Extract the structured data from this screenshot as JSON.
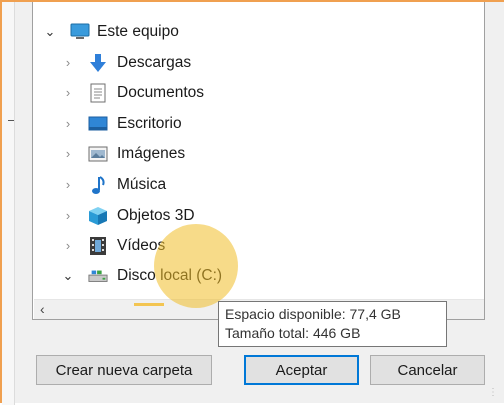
{
  "tree": {
    "items": [
      {
        "label": "Este equipo",
        "icon": "monitor-icon",
        "expanded": true
      },
      {
        "label": "Descargas",
        "icon": "download-arrow-icon"
      },
      {
        "label": "Documentos",
        "icon": "document-icon"
      },
      {
        "label": "Escritorio",
        "icon": "desktop-icon"
      },
      {
        "label": "Imágenes",
        "icon": "pictures-icon"
      },
      {
        "label": "Música",
        "icon": "music-note-icon"
      },
      {
        "label": "Objetos 3D",
        "icon": "3d-cube-icon"
      },
      {
        "label": "Vídeos",
        "icon": "film-icon"
      },
      {
        "label": "Disco local (C:)",
        "icon": "drive-icon",
        "expanded": true
      }
    ]
  },
  "tooltip": {
    "line1": "Espacio disponible: 77,4 GB",
    "line2": "Tamaño total: 446 GB"
  },
  "buttons": {
    "new_folder": "Crear nueva carpeta",
    "accept": "Aceptar",
    "cancel": "Cancelar"
  },
  "colors": {
    "accent": "#0078d7",
    "highlight": "#f0be28",
    "dialog_border": "#f0a050"
  }
}
